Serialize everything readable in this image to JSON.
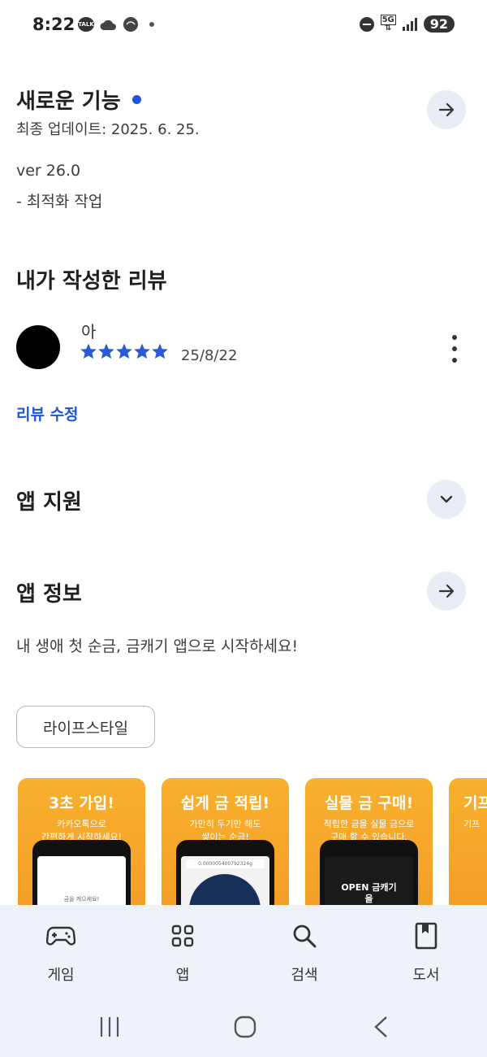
{
  "status_bar": {
    "time": "8:22",
    "talk_badge": "TALK",
    "network": "5G",
    "battery": "92"
  },
  "whats_new": {
    "title": "새로운 기능",
    "updated": "최종 업데이트: 2025. 6. 25.",
    "version": "ver 26.0",
    "notes": "- 최적화 작업"
  },
  "my_review": {
    "title": "내가 작성한 리뷰",
    "reviewer_name": "아",
    "rating": 5,
    "max_rating": 5,
    "date": "25/8/22",
    "edit_label": "리뷰 수정"
  },
  "app_support": {
    "title": "앱 지원"
  },
  "app_info": {
    "title": "앱 정보",
    "description": "내 생애 첫 순금, 금캐기 앱으로 시작하세요!",
    "category_chip": "라이프스타일"
  },
  "screenshots": [
    {
      "title": "3초 가입!",
      "subtitle": "카카오톡으로\n간편하게 시작하세요!",
      "screen_text": "금을 캐으세요!"
    },
    {
      "title": "쉽게 금 적립!",
      "subtitle": "가만히 두기만 해도\n쌓이는 순금!",
      "screen_text": "0.000005400792324g"
    },
    {
      "title": "실물 금 구매!",
      "subtitle": "적립한 금을 실물 금으로\n구매 할 수 있습니다.",
      "screen_text": "OPEN 금캐기 을"
    },
    {
      "title": "기프",
      "subtitle": "기프",
      "screen_text": ""
    }
  ],
  "bottom_nav": [
    {
      "label": "게임",
      "icon": "gamepad-icon"
    },
    {
      "label": "앱",
      "icon": "apps-grid-icon"
    },
    {
      "label": "검색",
      "icon": "search-icon"
    },
    {
      "label": "도서",
      "icon": "book-icon"
    }
  ],
  "colors": {
    "accent": "#1a56db",
    "star": "#2a5bd7",
    "nav_bg": "#eef3fa",
    "screenshot_orange": "#f6a52a"
  }
}
